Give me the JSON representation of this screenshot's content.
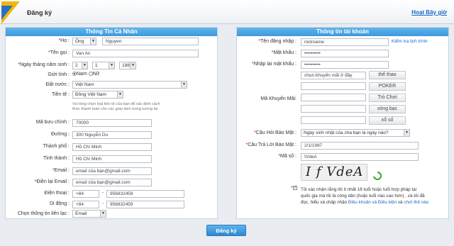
{
  "header": {
    "title": "Đăng ký",
    "login_link": "Hoạt Bây giờ"
  },
  "left": {
    "heading": "Thông Tin Cá Nhân",
    "ho_label": "Họ :",
    "title_value": "Ông",
    "lastname": "Nguyen",
    "ten_goi_label": "Tên gọi :",
    "ten_goi_value": "Van An",
    "dob_label": "Ngày tháng năm sinh :",
    "dob_day": "2",
    "dob_month": "1",
    "dob_year": "1987",
    "gioi_tinh_label": "Giới tính :",
    "nam": "Nam",
    "nu": "Nữ",
    "dat_nuoc_label": "Đất nước :",
    "dat_nuoc_value": "Việt Nam",
    "tien_te_label": "Tiền tệ :",
    "tien_te_value": "Đồng Việt Nam",
    "currency_note_1": "Vui lòng chọn loại tiền tệ của bạn để xác định cách",
    "currency_note_2": "thức thanh toán cho các giao dịch trong tương lai.",
    "ma_buu_chinh_label": "Mã bưu chính :",
    "ma_buu_chinh_value": "70000",
    "duong_label": "Đường :",
    "duong_value": "300 Nguyễn Du",
    "thanh_pho_label": "Thành phố :",
    "thanh_pho_value": "Hồ Chí Minh",
    "tinh_label": "Tỉnh thành :",
    "tinh_value": "Hồ Chí Minh",
    "email_label": "Email :",
    "email_value": "email của bạn@gmail.com",
    "email2_label": "Điền lại Email :",
    "email2_value": "email của bạn@gmail.com",
    "dien_thoai_label": "Điện thoại :",
    "dien_thoai_code": "+84",
    "dien_thoai_value": "956832459",
    "di_dong_label": "Di động :",
    "di_dong_code": "+84",
    "di_dong_value": "956832459",
    "lien_lac_label": "Chọn thông tin liên lạc :",
    "lien_lac_value": "Email",
    "dash": "-"
  },
  "right": {
    "heading": "Thông tin tài khoản",
    "username_label": "Tên đăng nhập :",
    "username_value": "nickname",
    "check_link": "Kiểm tra lịch trình",
    "password_label": "Mật khẩu :",
    "password_value": "••••••••••",
    "password2_label": "Nhập lại mật khẩu :",
    "password2_value": "••••••••••",
    "promo_label": "Mã Khuyến Mãi:",
    "promo_input": "chọn khuyến mãi ở đây",
    "promo_buttons": [
      "thể thao",
      "POKER",
      "Trò Chơi",
      "sòng bạc",
      "xổ số"
    ],
    "secq_label": "Câu Hỏi Bảo Mật :",
    "secq_value": "Ngày sinh nhật của cha bạn là ngày nào?",
    "seca_label": "Câu Trả Lời Bảo Mật :",
    "seca_value": "2/1/1987",
    "code_label": "Mã số :",
    "code_value": "IVdeA",
    "captcha_text": "I f VdeA",
    "terms_1": "Tôi xác nhận rằng tôi ít nhất 18 tuổi hoặc tuổi hợp pháp tại",
    "terms_2": "quốc gia mà tôi là công dân (hoặc tuổi nào cao hơn) , và tôi đã",
    "terms_3_a": "đọc, hiểu và chấp nhận ",
    "terms_3_link1": "Điều khoản và Điều kiện",
    "terms_3_b": " và ",
    "terms_3_link2": "chơi thế nào"
  },
  "submit_label": "Đăng ký"
}
